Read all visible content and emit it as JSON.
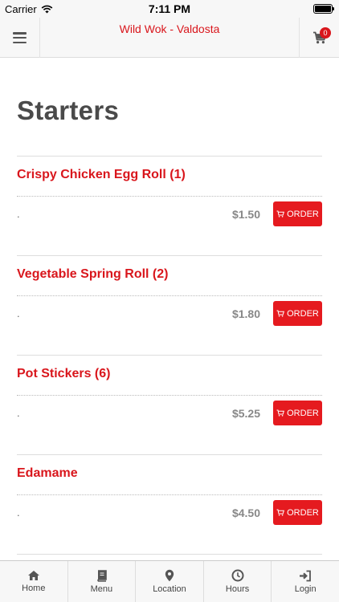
{
  "status_bar": {
    "carrier": "Carrier",
    "time": "7:11 PM"
  },
  "header": {
    "title": "Wild Wok - Valdosta",
    "cart_count": "0"
  },
  "section": {
    "title": "Starters"
  },
  "items": [
    {
      "name": "Crispy Chicken Egg Roll (1)",
      "description": ".",
      "price": "$1.50",
      "order_label": "ORDER"
    },
    {
      "name": "Vegetable Spring Roll (2)",
      "description": ".",
      "price": "$1.80",
      "order_label": "ORDER"
    },
    {
      "name": "Pot Stickers (6)",
      "description": ".",
      "price": "$5.25",
      "order_label": "ORDER"
    },
    {
      "name": "Edamame",
      "description": ".",
      "price": "$4.50",
      "order_label": "ORDER"
    }
  ],
  "tabs": [
    {
      "label": "Home",
      "icon": "home-icon"
    },
    {
      "label": "Menu",
      "icon": "book-icon"
    },
    {
      "label": "Location",
      "icon": "location-pin-icon"
    },
    {
      "label": "Hours",
      "icon": "clock-icon"
    },
    {
      "label": "Login",
      "icon": "login-icon"
    }
  ],
  "colors": {
    "accent": "#d9161c",
    "order_button": "#e51a1f"
  }
}
